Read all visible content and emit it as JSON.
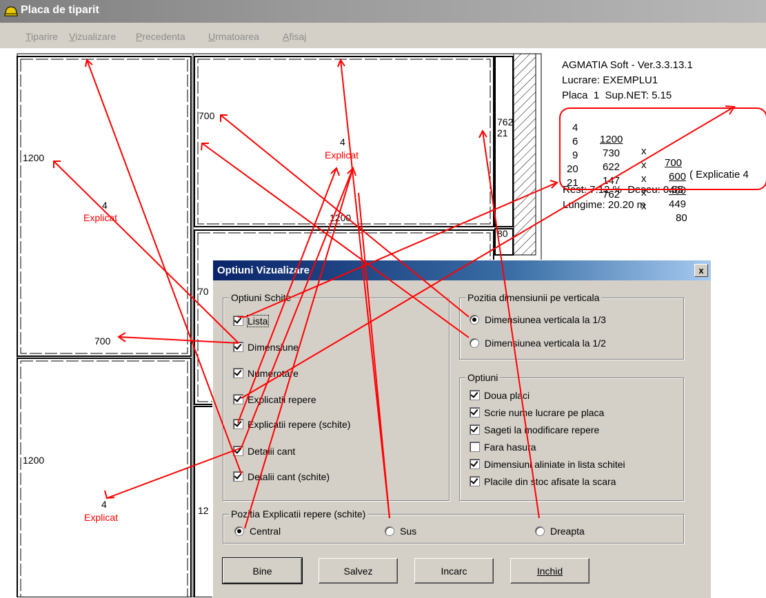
{
  "window": {
    "title": "Placa de tiparit"
  },
  "menu": {
    "items": [
      {
        "label": "Tiparire",
        "u": "T",
        "rest": "iparire"
      },
      {
        "label": "Vizualizare",
        "u": "V",
        "rest": "izualizare"
      },
      {
        "label": "Precedenta",
        "u": "P",
        "rest": "recedenta"
      },
      {
        "label": "Urmatoarea",
        "u": "U",
        "rest": "rmatoarea"
      },
      {
        "label": "Afisaj",
        "u": "A",
        "rest": "fisaj"
      }
    ]
  },
  "sheet": {
    "dims": {
      "d1200a": "1200",
      "d700a": "700",
      "d1200b": "1200",
      "d700b": "700",
      "d1200c": "1200",
      "d762": "762",
      "d21": "21",
      "d80": "80",
      "d70": "70",
      "d12": "12"
    },
    "labels": {
      "n4a": "4",
      "n4b": "4",
      "n4c": "4",
      "explicat": "Explicat"
    }
  },
  "info": {
    "line1": "AGMATIA Soft - Ver.3.3.13.1",
    "line2": "Lucrare: EXEMPLU1",
    "line3": "Placa  1  Sup.NET: 5.15",
    "rest": "Rest: 7.12 %  Deseu: 0.55",
    "lungime": "Lungime: 20.20 m"
  },
  "parts": [
    {
      "n": "4",
      "a": "1200",
      "x": "x",
      "b": "700",
      "note": "( Explicatie 4"
    },
    {
      "n": "6",
      "a": "730",
      "x": "x",
      "b": "600",
      "note": ""
    },
    {
      "n": "9",
      "a": "622",
      "x": "x",
      "b": "400",
      "note": ""
    },
    {
      "n": "20",
      "a": "147",
      "x": "x",
      "b": "449",
      "note": ""
    },
    {
      "n": "21",
      "a": "762",
      "x": "x",
      "b": "80",
      "note": ""
    }
  ],
  "dialog": {
    "title": "Optiuni Vizualizare",
    "close": "x",
    "schite": {
      "label": "Optiuni Schite",
      "items": [
        {
          "label": "Lista",
          "checked": true
        },
        {
          "label": "Dimensiune",
          "checked": true
        },
        {
          "label": "Numerotare",
          "checked": true
        },
        {
          "label": "Explicatii repere",
          "checked": true
        },
        {
          "label": "Explicatii repere (schite)",
          "checked": true
        },
        {
          "label": "Detalii cant",
          "checked": true
        },
        {
          "label": "Detalii cant (schite)",
          "checked": true
        }
      ]
    },
    "pozitia_dim": {
      "label": "Pozitia dimensiunii pe verticala",
      "options": [
        {
          "label": "Dimensiunea verticala la 1/3",
          "selected": true
        },
        {
          "label": "Dimensiunea verticala la 1/2",
          "selected": false
        }
      ]
    },
    "optiuni": {
      "label": "Optiuni",
      "items": [
        {
          "label": "Doua placi",
          "checked": true
        },
        {
          "label": "Scrie nume lucrare pe placa",
          "checked": true
        },
        {
          "label": "Sageti la modificare repere",
          "checked": true
        },
        {
          "label": "Fara hasura",
          "checked": false
        },
        {
          "label": "Dimensiuni aliniate in lista schitei",
          "checked": true
        },
        {
          "label": "Placile din stoc afisate la scara",
          "checked": true
        }
      ]
    },
    "pozitia_expl": {
      "label": "Pozitia Explicatii repere (schite)",
      "options": [
        {
          "label": "Central",
          "selected": true
        },
        {
          "label": "Sus",
          "selected": false
        },
        {
          "label": "Dreapta",
          "selected": false
        }
      ]
    },
    "buttons": {
      "bine": "Bine",
      "salvez": "Salvez",
      "incarc": "Incarc",
      "inchid": "Inchid"
    }
  },
  "colors": {
    "annotation": "#ff0000",
    "dialog_bg": "#d4d0c8",
    "title_blue": "#0a246a"
  }
}
